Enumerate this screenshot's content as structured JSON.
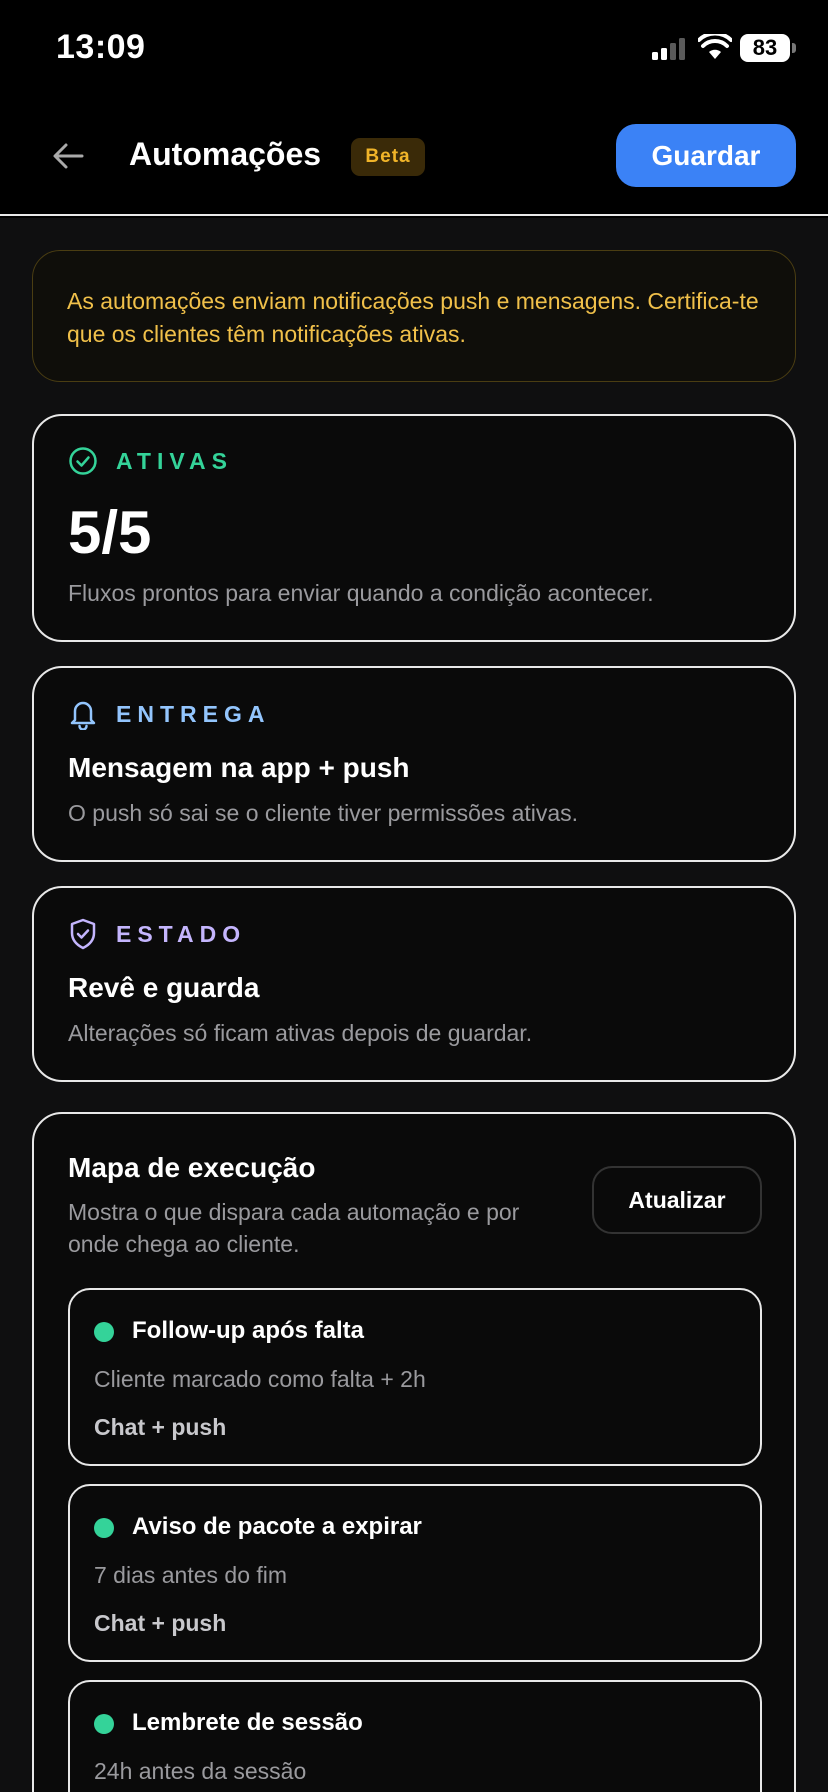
{
  "status_bar": {
    "time": "13:09",
    "battery": "83"
  },
  "header": {
    "title": "Automações",
    "badge": "Beta",
    "save_label": "Guardar"
  },
  "notice": {
    "text": "As automações enviam notificações push e mensagens. Certifica-te que os clientes têm notificações ativas."
  },
  "cards": {
    "active": {
      "label": "ATIVAS",
      "value": "5/5",
      "description": "Fluxos prontos para enviar quando a condição acontecer.",
      "icon": "check-circle-icon",
      "color": "#34d399"
    },
    "delivery": {
      "label": "ENTREGA",
      "heading": "Mensagem na app + push",
      "description": "O push só sai se o cliente tiver permissões ativas.",
      "icon": "bell-icon",
      "color": "#93c5fd"
    },
    "state": {
      "label": "ESTADO",
      "heading": "Revê e guarda",
      "description": "Alterações só ficam ativas depois de guardar.",
      "icon": "shield-check-icon",
      "color": "#c4b5fd"
    }
  },
  "execution_map": {
    "title": "Mapa de execução",
    "description": "Mostra o que dispara cada automação e por onde chega ao cliente.",
    "refresh_label": "Atualizar",
    "flows": [
      {
        "name": "Follow-up após falta",
        "trigger": "Cliente marcado como falta + 2h",
        "channel": "Chat + push",
        "status_color": "#34d399"
      },
      {
        "name": "Aviso de pacote a expirar",
        "trigger": "7 dias antes do fim",
        "channel": "Chat + push",
        "status_color": "#34d399"
      },
      {
        "name": "Lembrete de sessão",
        "trigger": "24h antes da sessão",
        "channel": "",
        "status_color": "#34d399"
      }
    ]
  },
  "colors": {
    "accent": "#3b82f6",
    "warning": "#f0c04a"
  }
}
